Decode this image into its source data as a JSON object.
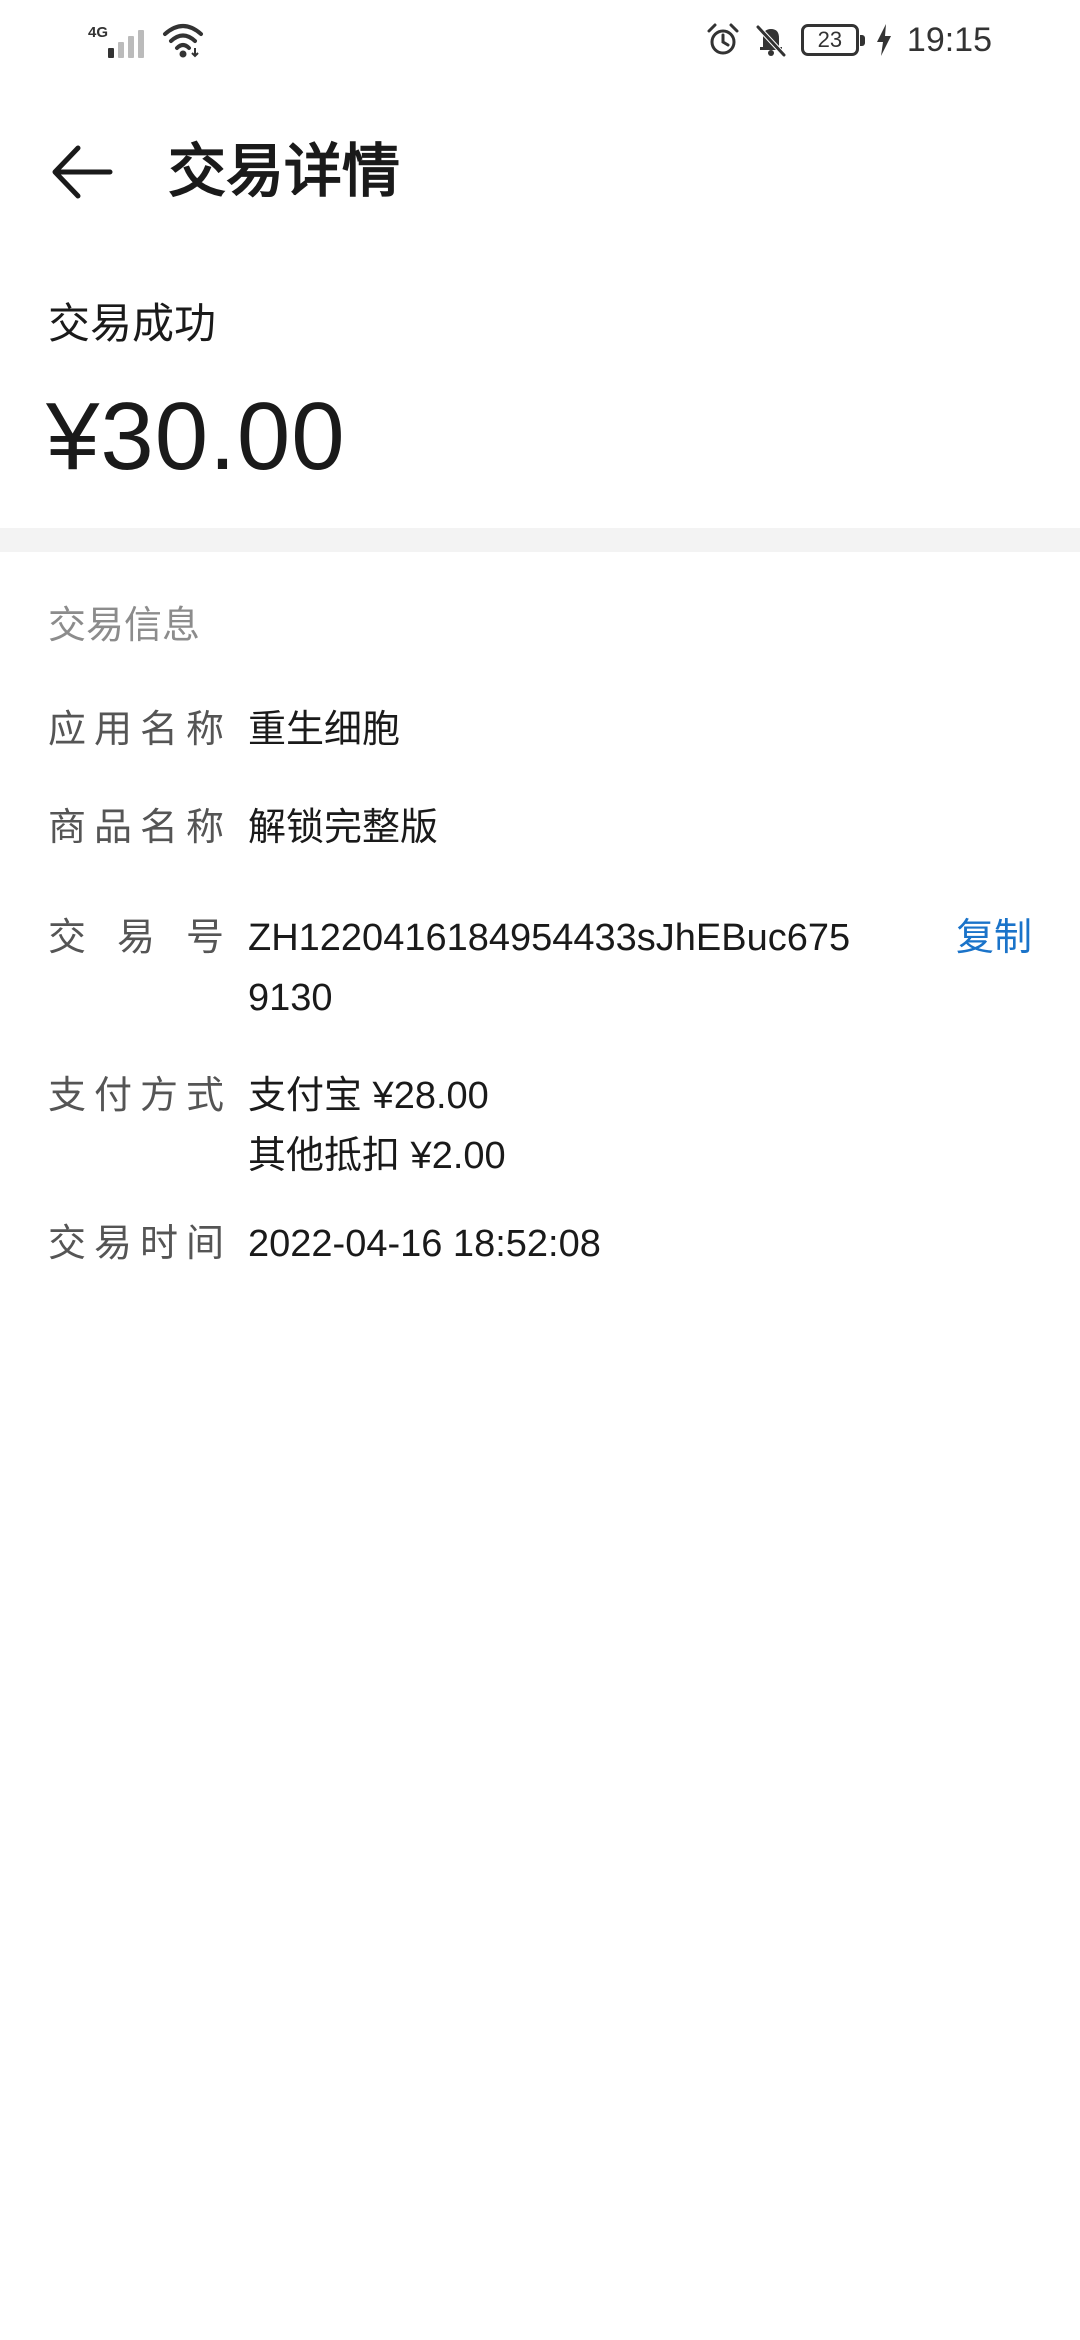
{
  "status_bar": {
    "network": "4G",
    "time": "19:15",
    "battery": "23",
    "icons": [
      "signal-icon",
      "wifi-icon",
      "alarm-icon",
      "bell-off-icon",
      "battery-icon",
      "charging-icon"
    ]
  },
  "header": {
    "title": "交易详情",
    "back_icon": "back-arrow-icon"
  },
  "summary": {
    "status": "交易成功",
    "amount": "¥30.00"
  },
  "info": {
    "section_title": "交易信息",
    "app_name_label": "应用名称",
    "app_name": "重生细胞",
    "product_label": "商品名称",
    "product": "解锁完整版",
    "txid_label": "交 易 号",
    "txid": "ZH1220416184954433sJhEBuc6759130",
    "copy_label": "复制",
    "payment_label": "支付方式",
    "payment_line1": "支付宝 ¥28.00",
    "payment_line2": "其他抵扣 ¥2.00",
    "time_label": "交易时间",
    "time": "2022-04-16 18:52:08"
  },
  "colors": {
    "accent": "#1a73c9",
    "label": "#555555",
    "section_title": "#8c8c8c",
    "divider": "#f3f3f3"
  }
}
